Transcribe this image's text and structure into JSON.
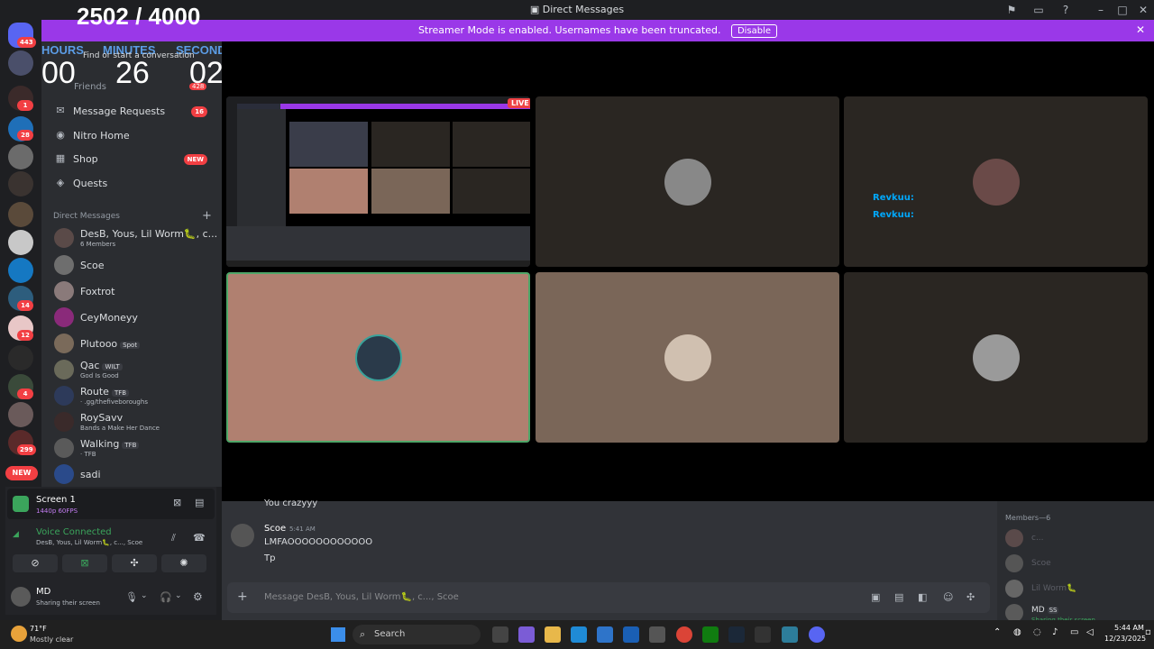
{
  "window": {
    "title": "Direct Messages"
  },
  "banner": {
    "text": "Streamer Mode is enabled. Usernames have been truncated.",
    "disable_label": "Disable"
  },
  "timer_overlay": {
    "count": "2502 / 4000",
    "hours_label": "HOURS",
    "minutes_label": "MINUTES",
    "seconds_label": "SECONDS",
    "hours": "00",
    "minutes": "26",
    "seconds": "02"
  },
  "rail": {
    "home_badge": "443",
    "badges": [
      "1",
      "28",
      "14",
      "12",
      "4",
      "299"
    ],
    "new_label": "NEW"
  },
  "sidebar": {
    "search_placeholder": "Find or start a conversation",
    "friends_label": "Friends",
    "friends_count": "428",
    "nav": [
      {
        "label": "Message Requests",
        "badge": "16"
      },
      {
        "label": "Nitro Home",
        "badge": ""
      },
      {
        "label": "Shop",
        "badge": "NEW"
      },
      {
        "label": "Quests",
        "badge": ""
      }
    ],
    "dm_header": "Direct Messages",
    "dms": [
      {
        "name": "DesB, Yous, Lil Worm🐛, c...",
        "sub": "6 Members",
        "tag": ""
      },
      {
        "name": "Scoe",
        "sub": "",
        "tag": ""
      },
      {
        "name": "Foxtrot",
        "sub": "",
        "tag": ""
      },
      {
        "name": "CeyMoneyy",
        "sub": "",
        "tag": ""
      },
      {
        "name": "Plutooo",
        "sub": "",
        "tag": "Spot"
      },
      {
        "name": "Qac",
        "sub": "God Is Good",
        "tag": "WILT"
      },
      {
        "name": "Route",
        "sub": "· .gg/thefiveboroughs",
        "tag": "TFB"
      },
      {
        "name": "RoySavv",
        "sub": "Bands a Make Her Dance",
        "tag": ""
      },
      {
        "name": "Walking",
        "sub": "· TFB",
        "tag": "TFB"
      },
      {
        "name": "sadi",
        "sub": "",
        "tag": ""
      }
    ]
  },
  "stage": {
    "live_label": "LIVE",
    "reactions": [
      "Revkuu:",
      "Revkuu:"
    ]
  },
  "share_panel": {
    "screen_title": "Screen 1",
    "screen_sub": "1440p 60FPS",
    "voice_status": "Voice Connected",
    "voice_members": "DesB, Yous, Lil Worm🐛, c..., Scoe",
    "user_name": "MD",
    "user_status": "Sharing their screen"
  },
  "chat": {
    "prev_line": "You crazyyy",
    "author": "Scoe",
    "time": "5:41 AM",
    "lines": [
      "LMFAOOOOOOOOOOOO",
      "Tp"
    ],
    "composer_placeholder": "Message DesB, Yous, Lil Worm🐛, c..., Scoe"
  },
  "members": {
    "header": "Members—6",
    "list": [
      "c...",
      "Scoe",
      "Lil Worm🐛",
      "MD"
    ],
    "md_tag": "SS",
    "md_status": "Sharing their screen"
  },
  "taskbar": {
    "weather_temp": "71°F",
    "weather_desc": "Mostly clear",
    "search_label": "Search",
    "time": "5:44 AM",
    "date": "12/23/2025"
  }
}
